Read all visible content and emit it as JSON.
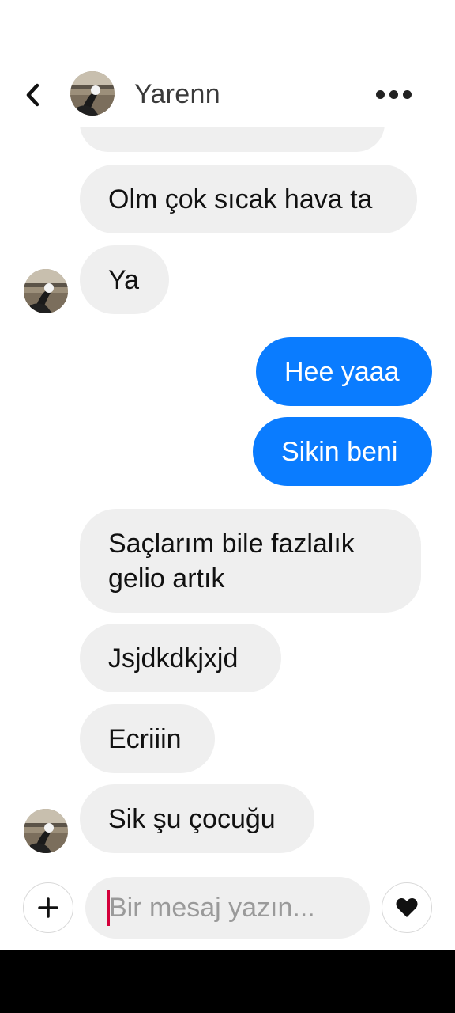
{
  "header": {
    "contact_name": "Yarenn"
  },
  "messages": [
    {
      "side": "in",
      "text": "Olm çok sıcak hava ta"
    },
    {
      "side": "in",
      "text": "Ya"
    },
    {
      "side": "out",
      "text": "Hee yaaa"
    },
    {
      "side": "out",
      "text": "Sikin beni"
    },
    {
      "side": "in",
      "text": "Saçlarım bile fazlalık gelio artık",
      "line1": "Saçlarım bile fazlalık",
      "line2": "gelio artık"
    },
    {
      "side": "in",
      "text": "Jsjdkdkjxjd"
    },
    {
      "side": "in",
      "text": "Ecriiin"
    },
    {
      "side": "in",
      "text": "Sik şu çocuğu"
    }
  ],
  "composer": {
    "placeholder": "Bir mesaj yazın...",
    "value": ""
  },
  "colors": {
    "outgoing_bubble": "#0a7cff",
    "incoming_bubble": "#efefef",
    "caret": "#d4003a"
  },
  "icons": {
    "back": "chevron-left-icon",
    "more": "more-horizontal-icon",
    "add": "plus-icon",
    "like": "heart-icon"
  }
}
